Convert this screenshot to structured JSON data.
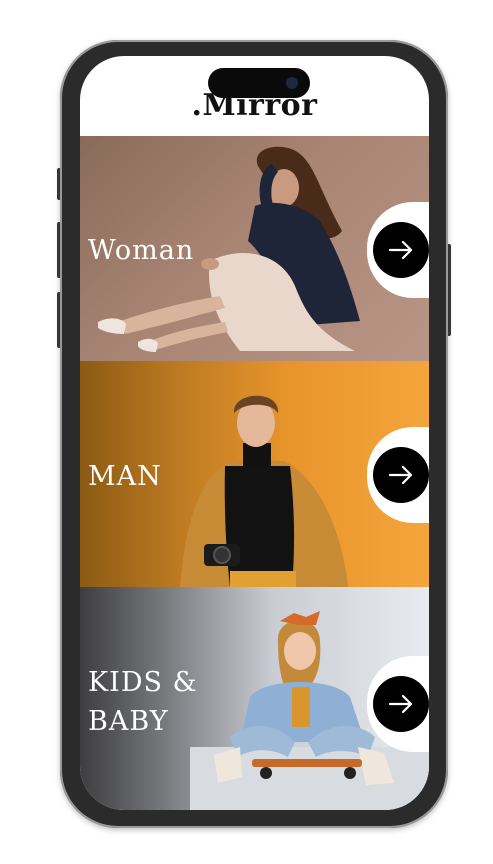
{
  "app": {
    "logo": ".Mirror"
  },
  "categories": [
    {
      "label": "Woman",
      "icon": "arrow-right-icon"
    },
    {
      "label": "MAN",
      "icon": "arrow-right-icon"
    },
    {
      "label": "KIDS &\nBABY",
      "icon": "arrow-right-icon"
    }
  ],
  "colors": {
    "woman_bg": "#a88473",
    "man_bg": "#f4a53c",
    "kids_bg": "#d9dce1",
    "arrow_button": "#000000",
    "frame": "#2b2b2b"
  }
}
